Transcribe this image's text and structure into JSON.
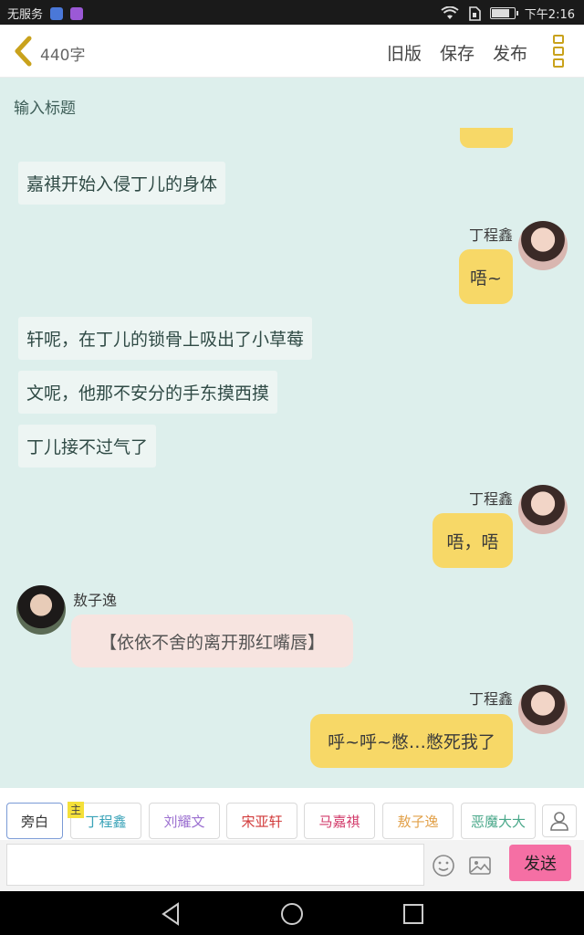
{
  "status_bar": {
    "carrier": "无服务",
    "time": "下午2:16",
    "battery_level": 0.75
  },
  "header": {
    "word_count": "440字",
    "actions": [
      "旧版",
      "保存",
      "发布"
    ]
  },
  "title_placeholder": "输入标题",
  "messages": {
    "narr1": "嘉祺开始入侵丁儿的身体",
    "ding1_name": "丁程鑫",
    "ding1_text": "唔~",
    "narr2": "轩呢，在丁儿的锁骨上吸出了小草莓",
    "narr3": "文呢，他那不安分的手东摸西摸",
    "narr4": "丁儿接不过气了",
    "ding2_name": "丁程鑫",
    "ding2_text": "唔，唔",
    "ao_name": "敖子逸",
    "ao_text": "【依依不舍的离开那红嘴唇】",
    "ding3_name": "丁程鑫",
    "ding3_text": "呼~呼~憋…憋死我了"
  },
  "characters": {
    "main_tag": "主",
    "chips": [
      "旁白",
      "丁程鑫",
      "刘耀文",
      "宋亚轩",
      "马嘉祺",
      "敖子逸",
      "恶魔大大"
    ],
    "colors": [
      "#555555",
      "#3aa3b8",
      "#9b6fd0",
      "#d23a3a",
      "#d23a6a",
      "#e2a14a",
      "#4aa88a"
    ]
  },
  "input": {
    "value": "",
    "send_label": "发送"
  },
  "accent_colors": {
    "yellow_bubble": "#f7d867",
    "send_button": "#f56fa4",
    "background": "#ddefec"
  }
}
